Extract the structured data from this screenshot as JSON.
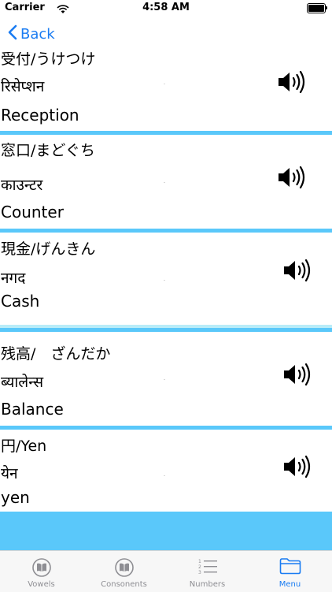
{
  "status_bar": {
    "carrier": "Carrier",
    "time": "4:58 AM"
  },
  "nav": {
    "back_label": "Back"
  },
  "rows": [
    {
      "japanese": "受付/うけつけ",
      "nepali": "रिसेप्शन",
      "english": "Reception",
      "icon": "speaker-icon"
    },
    {
      "japanese": "窓口/まどぐち",
      "nepali": "काउन्टर",
      "english": "Counter",
      "icon": "speaker-icon"
    },
    {
      "japanese": "現金/げんきん",
      "nepali": "नगद",
      "english": "Cash",
      "icon": "speaker-icon"
    },
    {
      "japanese": "残高/　ざんだか",
      "nepali": "ब्यालेन्स",
      "english": "Balance",
      "icon": "speaker-icon"
    },
    {
      "japanese": "円/Yen",
      "nepali": "येन",
      "english": "yen",
      "icon": "speaker-icon"
    }
  ],
  "tabs": [
    {
      "label": "Vowels",
      "icon": "book-icon",
      "active": false
    },
    {
      "label": "Consonents",
      "icon": "book-icon",
      "active": false
    },
    {
      "label": "Numbers",
      "icon": "numbered-list-icon",
      "active": false
    },
    {
      "label": "Menu",
      "icon": "folder-icon",
      "active": true
    }
  ],
  "colors": {
    "accent": "#1a7cf2",
    "separator": "#5ac8fa",
    "inactive_tab": "#8e8e93"
  }
}
